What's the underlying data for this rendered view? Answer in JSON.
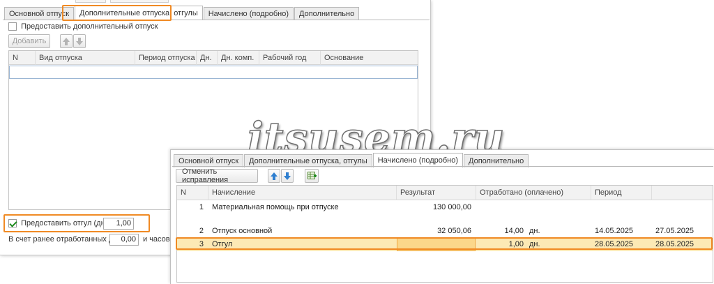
{
  "back_window": {
    "tabs": [
      {
        "label": "Основной отпуск"
      },
      {
        "label": "Дополнительные отпуска, отгулы"
      },
      {
        "label": "Начислено (подробно)"
      },
      {
        "label": "Дополнительно"
      }
    ],
    "provide_additional_leave": {
      "label": "Предоставить дополнительный отпуск",
      "checked": false
    },
    "add_button": "Добавить",
    "grid_columns": [
      "N",
      "Вид отпуска",
      "Период отпуска",
      "Дн.",
      "Дн. комп.",
      "Рабочий год",
      "Основание"
    ],
    "provide_time_off": {
      "label": "Предоставить отгул (дней)",
      "checked": true,
      "value": "1,00"
    },
    "previously_worked": {
      "label": "В счет ранее отработанных дней:",
      "value": "0,00",
      "hours_label": "и часов"
    }
  },
  "front_window": {
    "tabs": [
      {
        "label": "Основной отпуск"
      },
      {
        "label": "Дополнительные отпуска, отгулы"
      },
      {
        "label": "Начислено (подробно)"
      },
      {
        "label": "Дополнительно"
      }
    ],
    "cancel_corrections_button": "Отменить исправления",
    "grid_columns": [
      "N",
      "Начисление",
      "Результат",
      "Отработано (оплачено)",
      "Период",
      ""
    ],
    "rows": [
      {
        "n": "1",
        "accrual": "Материальная помощь при отпуске",
        "result": "130 000,00",
        "worked": "",
        "unit": "",
        "period_from": "",
        "period_to": ""
      },
      {
        "n": "2",
        "accrual": "Отпуск основной",
        "result": "32 050,06",
        "worked": "14,00",
        "unit": "дн.",
        "period_from": "14.05.2025",
        "period_to": "27.05.2025"
      },
      {
        "n": "3",
        "accrual": "Отгул",
        "result": "",
        "worked": "1,00",
        "unit": "дн.",
        "period_from": "28.05.2025",
        "period_to": "28.05.2025"
      }
    ]
  },
  "watermark": "itsusem.ru",
  "colors": {
    "highlight": "#f08a24",
    "selected_row": "#fce9b5",
    "selected_cell": "#fbd78a",
    "arrow_blue": "#2f7fd0"
  }
}
